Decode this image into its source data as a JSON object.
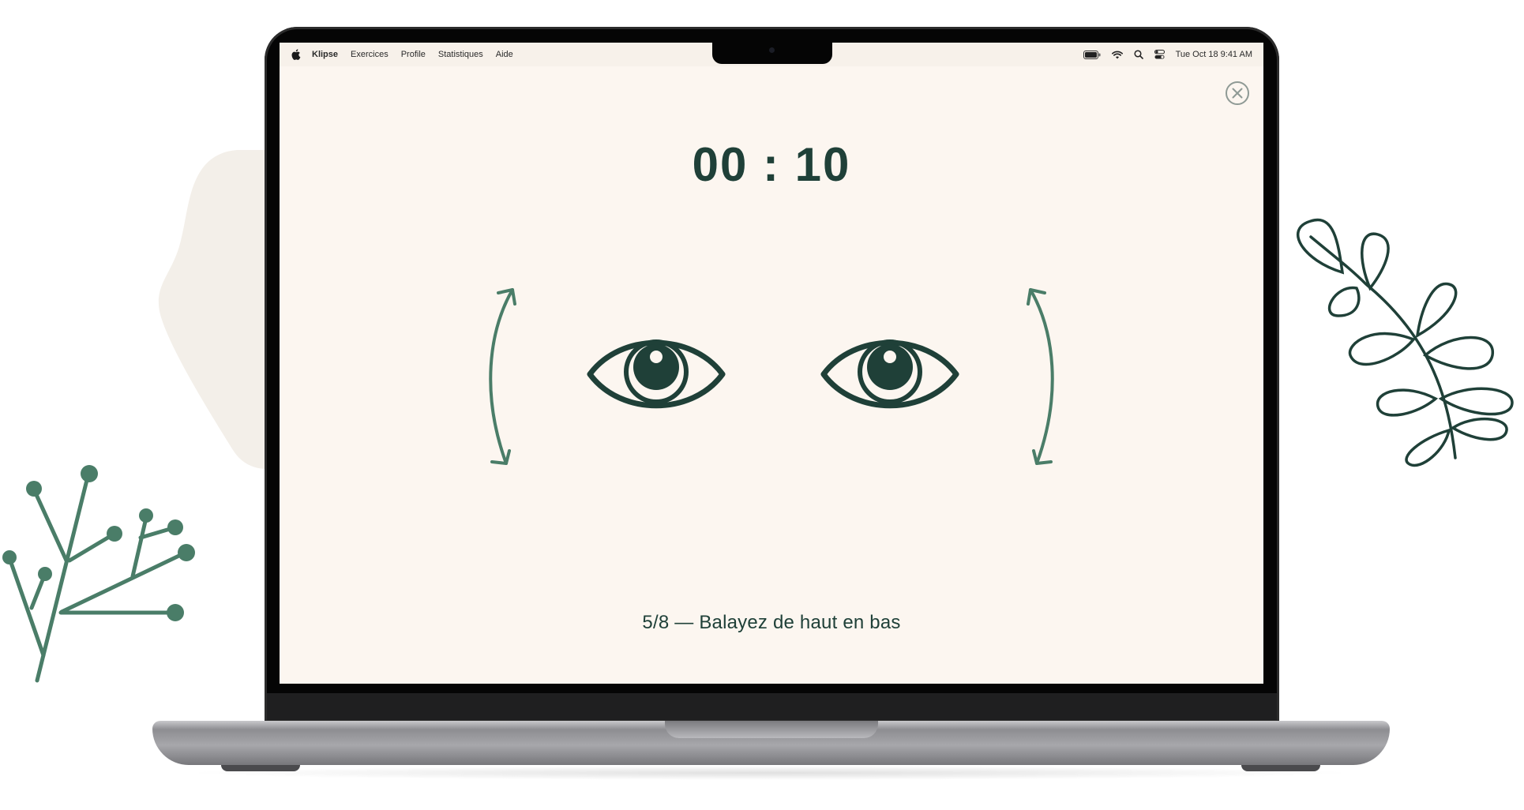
{
  "menubar": {
    "app_name": "Klipse",
    "items": [
      "Exercices",
      "Profile",
      "Statistiques",
      "Aide"
    ],
    "datetime": "Tue Oct 18  9:41 AM",
    "status_icons": [
      "battery-icon",
      "wifi-icon",
      "search-icon",
      "control-center-icon"
    ]
  },
  "exercise": {
    "timer": "00 : 10",
    "instruction": "5/8 — Balayez de haut en bas"
  },
  "colors": {
    "accent_dark": "#1f4038",
    "accent_green": "#4a7d68",
    "screen_bg": "#fcf6f0",
    "blob": "#f3efe9"
  }
}
